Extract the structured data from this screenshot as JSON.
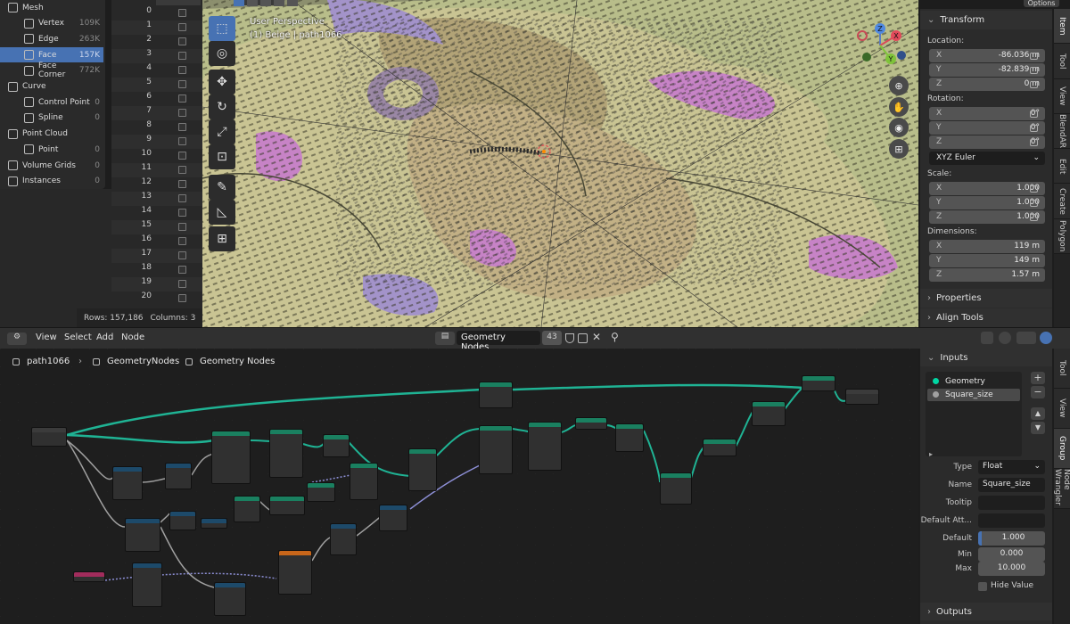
{
  "spreadsheet": {
    "tree": [
      {
        "label": "Mesh",
        "count": "",
        "indent": 0,
        "icon": "mesh-icon",
        "selected": false
      },
      {
        "label": "Vertex",
        "count": "109K",
        "indent": 1,
        "icon": "vertex-icon",
        "selected": false
      },
      {
        "label": "Edge",
        "count": "263K",
        "indent": 1,
        "icon": "edge-icon",
        "selected": false
      },
      {
        "label": "Face",
        "count": "157K",
        "indent": 1,
        "icon": "face-icon",
        "selected": true
      },
      {
        "label": "Face Corner",
        "count": "772K",
        "indent": 1,
        "icon": "face-corner-icon",
        "selected": false
      },
      {
        "label": "Curve",
        "count": "",
        "indent": 0,
        "icon": "curve-icon",
        "selected": false
      },
      {
        "label": "Control Point",
        "count": "0",
        "indent": 1,
        "icon": "control-point-icon",
        "selected": false
      },
      {
        "label": "Spline",
        "count": "0",
        "indent": 1,
        "icon": "spline-icon",
        "selected": false
      },
      {
        "label": "Point Cloud",
        "count": "",
        "indent": 0,
        "icon": "point-cloud-icon",
        "selected": false
      },
      {
        "label": "Point",
        "count": "0",
        "indent": 1,
        "icon": "point-icon",
        "selected": false
      },
      {
        "label": "Volume Grids",
        "count": "0",
        "indent": 0,
        "icon": "volume-icon",
        "selected": false
      },
      {
        "label": "Instances",
        "count": "0",
        "indent": 0,
        "icon": "instances-icon",
        "selected": false
      }
    ],
    "rows": [
      "0",
      "1",
      "2",
      "3",
      "4",
      "5",
      "6",
      "7",
      "8",
      "9",
      "10",
      "11",
      "12",
      "13",
      "14",
      "15",
      "16",
      "17",
      "18",
      "19",
      "20"
    ],
    "rows_label": "Rows: 157,186",
    "columns_label": "Columns: 3"
  },
  "viewport": {
    "line1": "User Perspective",
    "line2": "(1) Beige | path1066",
    "options": "Options"
  },
  "gizmo": {
    "x": "X",
    "y": "Y",
    "z": "Z"
  },
  "nav_icons": [
    "zoom-icon",
    "hand-pan-icon",
    "camera-icon",
    "grid-icon"
  ],
  "tools": [
    "select-box-icon",
    "cursor-icon",
    "move-icon",
    "rotate-icon",
    "scale-icon",
    "transform-icon",
    "annotate-icon",
    "measure-icon",
    "add-cube-icon"
  ],
  "transform": {
    "header": "Transform",
    "location_label": "Location:",
    "location": [
      {
        "axis": "X",
        "value": "-86.036 m"
      },
      {
        "axis": "Y",
        "value": "-82.839 m"
      },
      {
        "axis": "Z",
        "value": "0 m"
      }
    ],
    "rotation_label": "Rotation:",
    "rotation": [
      {
        "axis": "X",
        "value": "0°"
      },
      {
        "axis": "Y",
        "value": "0°"
      },
      {
        "axis": "Z",
        "value": "0°"
      }
    ],
    "rotation_mode": "XYZ Euler",
    "scale_label": "Scale:",
    "scale": [
      {
        "axis": "X",
        "value": "1.000"
      },
      {
        "axis": "Y",
        "value": "1.000"
      },
      {
        "axis": "Z",
        "value": "1.000"
      }
    ],
    "dimensions_label": "Dimensions:",
    "dimensions": [
      {
        "axis": "X",
        "value": "119 m"
      },
      {
        "axis": "Y",
        "value": "149 m"
      },
      {
        "axis": "Z",
        "value": "1.57 m"
      }
    ],
    "properties": "Properties",
    "align_tools": "Align Tools"
  },
  "viewport_tabs": [
    "Item",
    "Tool",
    "View",
    "BlendAR",
    "Edit",
    "Create",
    "Polygon"
  ],
  "node_header": {
    "menus": [
      "View",
      "Select",
      "Add",
      "Node"
    ],
    "tree_name": "Geometry Nodes",
    "users": "43"
  },
  "breadcrumb": [
    "path1066",
    "GeometryNodes",
    "Geometry Nodes"
  ],
  "group_panel": {
    "inputs_header": "Inputs",
    "sockets": [
      {
        "name": "Geometry",
        "color": "#00d6a3"
      },
      {
        "name": "Square_size",
        "color": "#a1a1a1"
      }
    ],
    "type_label": "Type",
    "type_value": "Float",
    "name_label": "Name",
    "name_value": "Square_size",
    "tooltip_label": "Tooltip",
    "tooltip_value": "",
    "default_attr_label": "Default Att...",
    "default_attr_value": "",
    "default_label": "Default",
    "default_value": "1.000",
    "min_label": "Min",
    "min_value": "0.000",
    "max_label": "Max",
    "max_value": "10.000",
    "hide_value": "Hide Value",
    "outputs_header": "Outputs"
  },
  "node_tabs": [
    "Tool",
    "View",
    "Group",
    "Node Wrangler"
  ]
}
